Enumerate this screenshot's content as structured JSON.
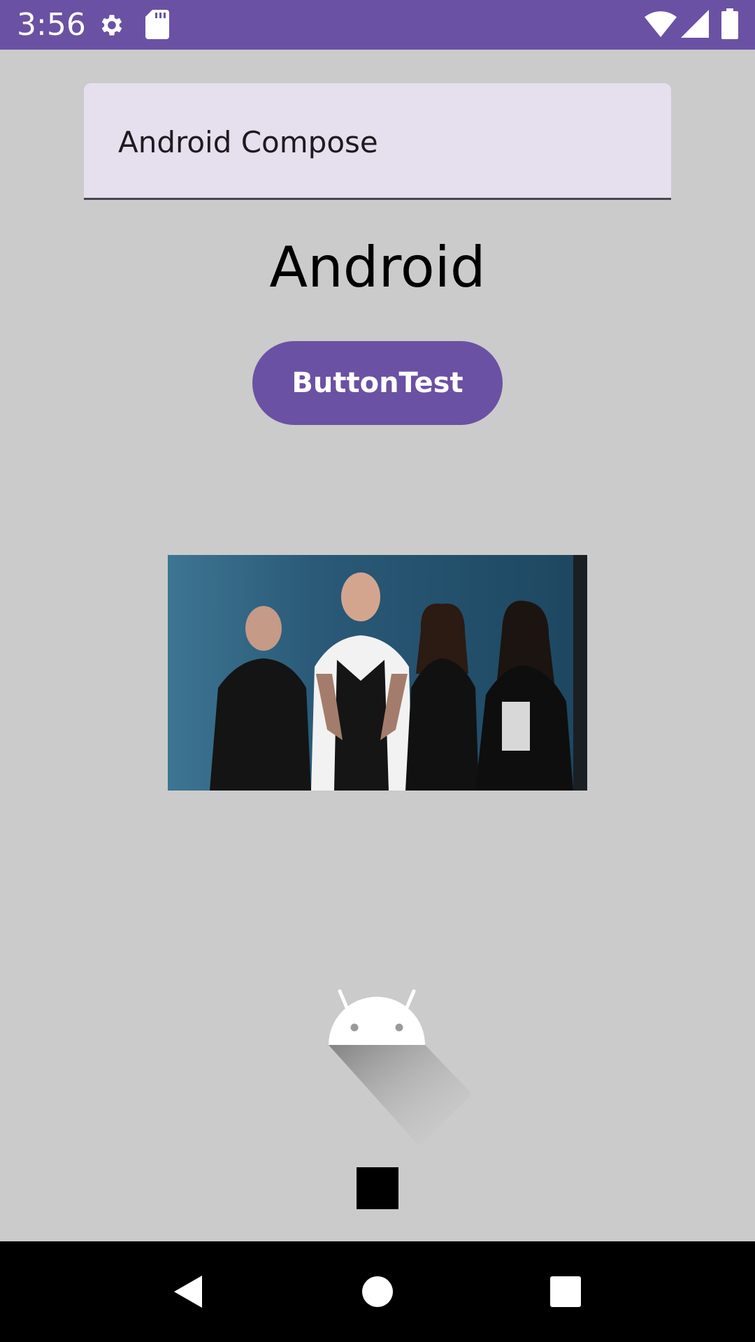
{
  "status_bar": {
    "time": "3:56",
    "background_color": "#6b51a3",
    "icons": [
      "gear-icon",
      "sd-card-icon",
      "wifi-icon",
      "cell-signal-icon",
      "battery-icon"
    ]
  },
  "text_field": {
    "value": "Android Compose"
  },
  "heading": {
    "text": "Android"
  },
  "button": {
    "label": "ButtonTest",
    "color": "#6b51a3"
  },
  "photo": {
    "icon": "band-photo"
  },
  "logo": {
    "icon": "android-logo-icon"
  },
  "nav_bar": {
    "buttons": [
      "back-icon",
      "home-icon",
      "recents-icon"
    ]
  }
}
